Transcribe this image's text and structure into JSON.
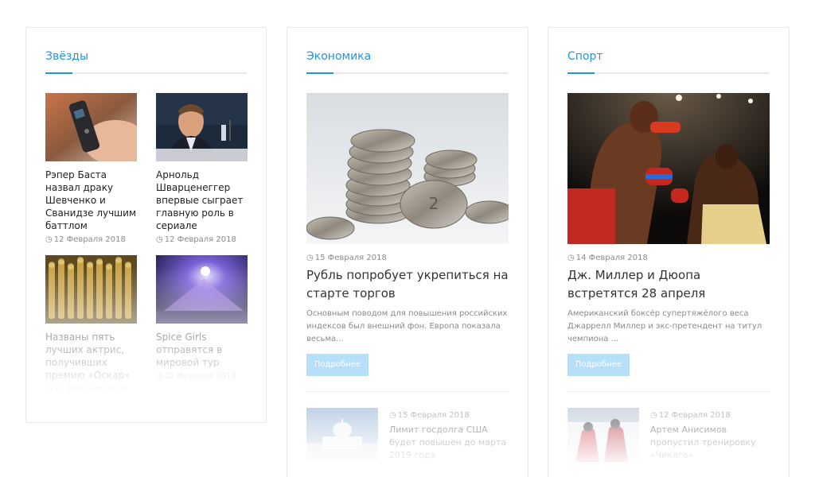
{
  "columns": [
    {
      "title": "Звёзды",
      "items": [
        {
          "title": "Рэпер Баста назвал драку Шевченко и Сванидзе лучшим баттлом",
          "date": "12 Февраля 2018"
        },
        {
          "title": "Арнольд Шварценеггер впервые сыграет главную роль в сериале",
          "date": "12 Февраля 2018"
        },
        {
          "title": "Названы пять лучших актрис, получивших премию «Оскар»",
          "date": "12 Февраля 2018"
        },
        {
          "title": "Spice Girls отправятся в мировой тур",
          "date": "12 Февраля 2018"
        }
      ]
    },
    {
      "title": "Экономика",
      "main": {
        "date": "15 Февраля 2018",
        "title": "Рубль попробует укрепиться на старте торгов",
        "excerpt": "Основным поводом для повышения российских индексов был внешний фон. Европа показала весьма..."
      },
      "more_label": "Подробнее",
      "secondary": {
        "date": "15 Февраля 2018",
        "title": "Лимит госдолга США будет повышен до марта 2019 года"
      }
    },
    {
      "title": "Спорт",
      "main": {
        "date": "14 Февраля 2018",
        "title": "Дж. Миллер и Дюопа встретятся 28 апреля",
        "excerpt": "Американский боксёр супертяжёлого веса Джаррелл Миллер и экс-претендент на титул чемпиона ..."
      },
      "more_label": "Подробнее",
      "secondary": {
        "date": "12 Февраля 2018",
        "title": "Артем Анисимов пропустил тренировку «Чикаго»"
      }
    }
  ],
  "icons": {
    "date": "clock-icon"
  },
  "colors": {
    "accent": "#2196e0",
    "button": "#b6e0fa",
    "muted": "#8a8a8a"
  }
}
